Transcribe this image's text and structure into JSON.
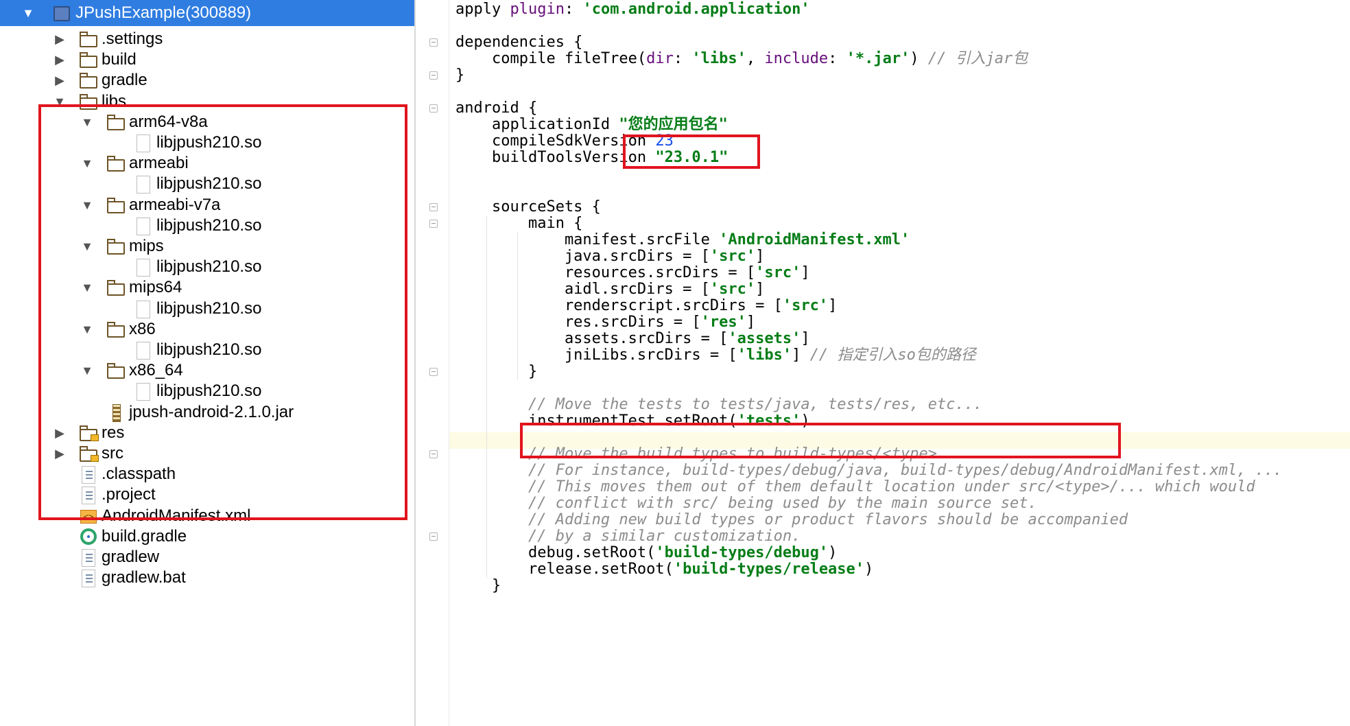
{
  "project_tree": {
    "root": {
      "label": "JPushExample(300889)"
    },
    "items": [
      {
        "label": ".settings",
        "icon": "folder-icon",
        "arrow": "▶"
      },
      {
        "label": "build",
        "icon": "folder-icon",
        "arrow": "▶"
      },
      {
        "label": "gradle",
        "icon": "folder-icon",
        "arrow": "▶"
      },
      {
        "label": "libs",
        "icon": "folder-icon",
        "arrow": "▼"
      },
      {
        "label": "arm64-v8a",
        "icon": "folder-icon",
        "arrow": "▼"
      },
      {
        "label": "libjpush210.so",
        "icon": "file-icon",
        "arrow": ""
      },
      {
        "label": "armeabi",
        "icon": "folder-icon",
        "arrow": "▼"
      },
      {
        "label": "libjpush210.so",
        "icon": "file-icon",
        "arrow": ""
      },
      {
        "label": "armeabi-v7a",
        "icon": "folder-icon",
        "arrow": "▼"
      },
      {
        "label": "libjpush210.so",
        "icon": "file-icon",
        "arrow": ""
      },
      {
        "label": "mips",
        "icon": "folder-icon",
        "arrow": "▼"
      },
      {
        "label": "libjpush210.so",
        "icon": "file-icon",
        "arrow": ""
      },
      {
        "label": "mips64",
        "icon": "folder-icon",
        "arrow": "▼"
      },
      {
        "label": "libjpush210.so",
        "icon": "file-icon",
        "arrow": ""
      },
      {
        "label": "x86",
        "icon": "folder-icon",
        "arrow": "▼"
      },
      {
        "label": "libjpush210.so",
        "icon": "file-icon",
        "arrow": ""
      },
      {
        "label": "x86_64",
        "icon": "folder-icon",
        "arrow": "▼"
      },
      {
        "label": "libjpush210.so",
        "icon": "file-icon",
        "arrow": ""
      },
      {
        "label": "jpush-android-2.1.0.jar",
        "icon": "jar-icon",
        "arrow": ""
      },
      {
        "label": "res",
        "icon": "source-folder-icon",
        "arrow": "▶"
      },
      {
        "label": "src",
        "icon": "source-folder-icon",
        "arrow": "▶"
      },
      {
        "label": ".classpath",
        "icon": "text-file-icon",
        "arrow": ""
      },
      {
        "label": ".project",
        "icon": "text-file-icon",
        "arrow": ""
      },
      {
        "label": "AndroidManifest.xml",
        "icon": "xml-file-icon",
        "arrow": ""
      },
      {
        "label": "build.gradle",
        "icon": "gradle-icon",
        "arrow": ""
      },
      {
        "label": "gradlew",
        "icon": "text-file-icon",
        "arrow": ""
      },
      {
        "label": "gradlew.bat",
        "icon": "text-file-icon",
        "arrow": ""
      }
    ]
  },
  "editor": {
    "lines": [
      [
        {
          "t": "apply ",
          "c": "kw"
        },
        {
          "t": "plugin",
          "c": "pn"
        },
        {
          "t": ": ",
          "c": "kw"
        },
        {
          "t": "'com.android.application'",
          "c": "st"
        }
      ],
      [],
      [
        {
          "t": "dependencies {",
          "c": "kw"
        }
      ],
      [
        {
          "t": "    compile fileTree(",
          "c": "kw"
        },
        {
          "t": "dir",
          "c": "pn"
        },
        {
          "t": ": ",
          "c": "kw"
        },
        {
          "t": "'libs'",
          "c": "st"
        },
        {
          "t": ", ",
          "c": "kw"
        },
        {
          "t": "include",
          "c": "pn"
        },
        {
          "t": ": ",
          "c": "kw"
        },
        {
          "t": "'*.jar'",
          "c": "st"
        },
        {
          "t": ") ",
          "c": "kw"
        },
        {
          "t": "// 引入jar包",
          "c": "cm"
        }
      ],
      [
        {
          "t": "}",
          "c": "kw"
        }
      ],
      [],
      [
        {
          "t": "android {",
          "c": "kw"
        }
      ],
      [
        {
          "t": "    applicationId ",
          "c": "kw"
        },
        {
          "t": "\"您的应用包名\"",
          "c": "st"
        }
      ],
      [
        {
          "t": "    compileSdkVersion ",
          "c": "kw"
        },
        {
          "t": "23",
          "c": "nm"
        }
      ],
      [
        {
          "t": "    buildToolsVersion ",
          "c": "kw"
        },
        {
          "t": "\"23.0.1\"",
          "c": "st"
        }
      ],
      [],
      [],
      [
        {
          "t": "    sourceSets {",
          "c": "kw"
        }
      ],
      [
        {
          "t": "        main {",
          "c": "kw"
        }
      ],
      [
        {
          "t": "            manifest.srcFile ",
          "c": "kw"
        },
        {
          "t": "'AndroidManifest.xml'",
          "c": "st"
        }
      ],
      [
        {
          "t": "            java.srcDirs = [",
          "c": "kw"
        },
        {
          "t": "'src'",
          "c": "st"
        },
        {
          "t": "]",
          "c": "kw"
        }
      ],
      [
        {
          "t": "            resources.srcDirs = [",
          "c": "kw"
        },
        {
          "t": "'src'",
          "c": "st"
        },
        {
          "t": "]",
          "c": "kw"
        }
      ],
      [
        {
          "t": "            aidl.srcDirs = [",
          "c": "kw"
        },
        {
          "t": "'src'",
          "c": "st"
        },
        {
          "t": "]",
          "c": "kw"
        }
      ],
      [
        {
          "t": "            renderscript.srcDirs = [",
          "c": "kw"
        },
        {
          "t": "'src'",
          "c": "st"
        },
        {
          "t": "]",
          "c": "kw"
        }
      ],
      [
        {
          "t": "            res.srcDirs = [",
          "c": "kw"
        },
        {
          "t": "'res'",
          "c": "st"
        },
        {
          "t": "]",
          "c": "kw"
        }
      ],
      [
        {
          "t": "            assets.srcDirs = [",
          "c": "kw"
        },
        {
          "t": "'assets'",
          "c": "st"
        },
        {
          "t": "]",
          "c": "kw"
        }
      ],
      [
        {
          "t": "            jniLibs.srcDirs = [",
          "c": "kw"
        },
        {
          "t": "'libs'",
          "c": "st"
        },
        {
          "t": "] ",
          "c": "kw"
        },
        {
          "t": "// 指定引入so包的路径",
          "c": "cm"
        }
      ],
      [
        {
          "t": "        }",
          "c": "kw"
        }
      ],
      [],
      [
        {
          "t": "        // Move the tests to tests/java, tests/res, etc...",
          "c": "cm"
        }
      ],
      [
        {
          "t": "        instrumentTest.setRoot(",
          "c": "kw"
        },
        {
          "t": "'tests'",
          "c": "st"
        },
        {
          "t": ")",
          "c": "kw"
        }
      ],
      [],
      [
        {
          "t": "        // Move the build types to build-types/<type>",
          "c": "cm"
        }
      ],
      [
        {
          "t": "        // For instance, build-types/debug/java, build-types/debug/AndroidManifest.xml, ...",
          "c": "cm"
        }
      ],
      [
        {
          "t": "        // This moves them out of them default location under src/<type>/... which would",
          "c": "cm"
        }
      ],
      [
        {
          "t": "        // conflict with src/ being used by the main source set.",
          "c": "cm"
        }
      ],
      [
        {
          "t": "        // Adding new build types or product flavors should be accompanied",
          "c": "cm"
        }
      ],
      [
        {
          "t": "        // by a similar customization.",
          "c": "cm"
        }
      ],
      [
        {
          "t": "        debug.setRoot(",
          "c": "kw"
        },
        {
          "t": "'build-types/debug'",
          "c": "st"
        },
        {
          "t": ")",
          "c": "kw"
        }
      ],
      [
        {
          "t": "        release.setRoot(",
          "c": "kw"
        },
        {
          "t": "'build-types/release'",
          "c": "st"
        },
        {
          "t": ")",
          "c": "kw"
        }
      ],
      [
        {
          "t": "    }",
          "c": "kw"
        }
      ]
    ]
  }
}
